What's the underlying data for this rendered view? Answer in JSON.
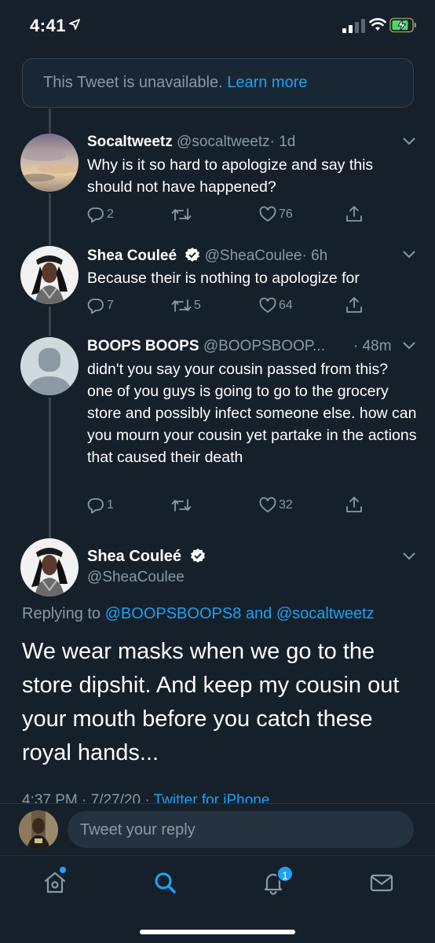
{
  "status_bar": {
    "time": "4:41"
  },
  "unavailable": {
    "text": "This Tweet is unavailable.",
    "link": "Learn more"
  },
  "tweets": [
    {
      "name": "Socaltweetz",
      "handle": "@socaltweetz",
      "time": "· 1d",
      "text": "Why is it so hard to apologize and say this should not have happened?",
      "replies": "2",
      "retweets": "",
      "likes": "76"
    },
    {
      "name": "Shea Couleé",
      "handle": "@SheaCoulee",
      "time": "· 6h",
      "text": "Because their is nothing to apologize for",
      "replies": "7",
      "retweets": "5",
      "likes": "64"
    },
    {
      "name": "BOOPS BOOPS",
      "handle": "@BOOPSBOOP...",
      "time": "· 48m",
      "text": "didn't you say your cousin passed from this? one of you guys is going to go to the grocery store and possibly infect someone else. how can you mourn your cousin yet partake in the actions that caused their death",
      "replies": "1",
      "retweets": "",
      "likes": "32"
    }
  ],
  "main_tweet": {
    "name": "Shea Couleé",
    "handle": "@SheaCoulee",
    "replying_prefix": "Replying to",
    "replying_to_1": "@BOOPSBOOPS8",
    "replying_and": "and",
    "replying_to_2": "@socaltweetz",
    "text": "We wear masks when we go to the store dipshit. And keep my cousin out your mouth before you catch these royal hands...",
    "meta_time": "4:37 PM · 7/27/20 ·",
    "meta_source": "Twitter for iPhone"
  },
  "reply_bar": {
    "placeholder": "Tweet your reply"
  },
  "tab_bar": {
    "notifications_badge": "1"
  },
  "colors": {
    "background": "#15202b",
    "accent": "#1da1f2",
    "muted": "#8899a6",
    "border": "#38444d"
  }
}
